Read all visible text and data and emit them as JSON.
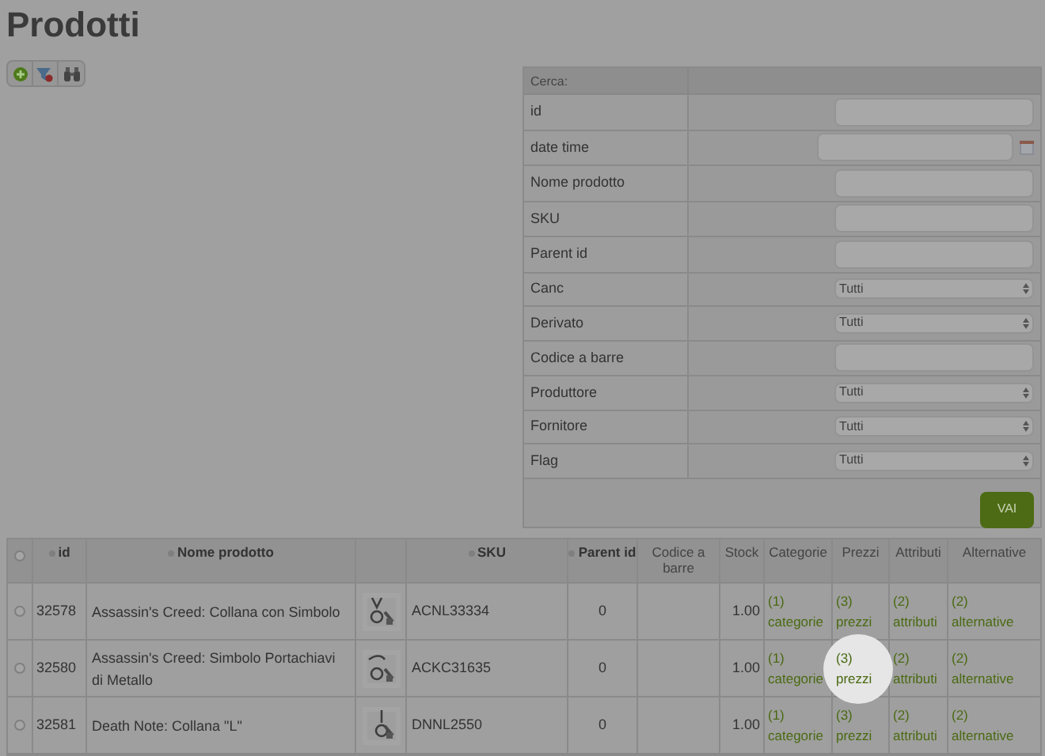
{
  "title": "Prodotti",
  "toolbar": [
    {
      "kind": "add"
    },
    {
      "kind": "filter"
    },
    {
      "kind": "binoculars"
    }
  ],
  "search": {
    "header": "Cerca:",
    "fields": [
      {
        "label": "id",
        "kind": "text"
      },
      {
        "label": "date time",
        "kind": "date"
      },
      {
        "label": "Nome prodotto",
        "kind": "text"
      },
      {
        "label": "SKU",
        "kind": "text"
      },
      {
        "label": "Parent id",
        "kind": "text"
      },
      {
        "label": "Canc",
        "kind": "select",
        "value": "Tutti"
      },
      {
        "label": "Derivato",
        "kind": "select",
        "value": "Tutti"
      },
      {
        "label": "Codice a barre",
        "kind": "text"
      },
      {
        "label": "Produttore",
        "kind": "select",
        "value": "Tutti"
      },
      {
        "label": "Fornitore",
        "kind": "select",
        "value": "Tutti"
      },
      {
        "label": "Flag",
        "kind": "select",
        "value": "Tutti"
      }
    ],
    "button": "VAI"
  },
  "table": {
    "select_all_checked": false,
    "columns": [
      {
        "label": "id",
        "sortable": true
      },
      {
        "label": "Nome prodotto",
        "sortable": true
      },
      {
        "sortable": false
      },
      {
        "label": "SKU",
        "sortable": true
      },
      {
        "label": "Parent id",
        "sortable": true
      },
      {
        "label": "Codice a barre",
        "sortable": false
      },
      {
        "label": "Stock",
        "sortable": false
      },
      {
        "label": "Categorie",
        "sortable": false
      },
      {
        "label": "Prezzi",
        "sortable": false
      },
      {
        "label": "Attributi",
        "sortable": false
      },
      {
        "label": "Alternative",
        "sortable": false
      }
    ],
    "rows": [
      {
        "checked": false,
        "id": "32578",
        "name": "Assassin's Creed: Collana con Simbolo",
        "sku": "ACNL33334",
        "parent_id": "0",
        "stock": "1.00",
        "links": [
          {
            "count": "(1)",
            "label": "categorie",
            "highlighted": false
          },
          {
            "count": "(3)",
            "label": "prezzi",
            "highlighted": false
          },
          {
            "count": "(2)",
            "label": "attributi",
            "highlighted": false
          },
          {
            "count": "(2)",
            "label": "alternative",
            "highlighted": false
          }
        ]
      },
      {
        "checked": false,
        "id": "32580",
        "name": "Assassin's Creed: Simbolo Portachiavi di Metallo",
        "sku": "ACKC31635",
        "parent_id": "0",
        "stock": "1.00",
        "links": [
          {
            "count": "(1)",
            "label": "categorie",
            "highlighted": false
          },
          {
            "count": "(3)",
            "label": "prezzi",
            "highlighted": true
          },
          {
            "count": "(2)",
            "label": "attributi",
            "highlighted": false
          },
          {
            "count": "(2)",
            "label": "alternative",
            "highlighted": false
          }
        ]
      },
      {
        "checked": false,
        "id": "32581",
        "name": "Death Note: Collana \"L\"",
        "sku": "DNNL2550",
        "parent_id": "0",
        "stock": "1.00",
        "links": [
          {
            "count": "(1)",
            "label": "categorie",
            "highlighted": false
          },
          {
            "count": "(3)",
            "label": "prezzi",
            "highlighted": false
          },
          {
            "count": "(2)",
            "label": "attributi",
            "highlighted": false
          },
          {
            "count": "(2)",
            "label": "alternative",
            "highlighted": false
          }
        ]
      }
    ]
  }
}
